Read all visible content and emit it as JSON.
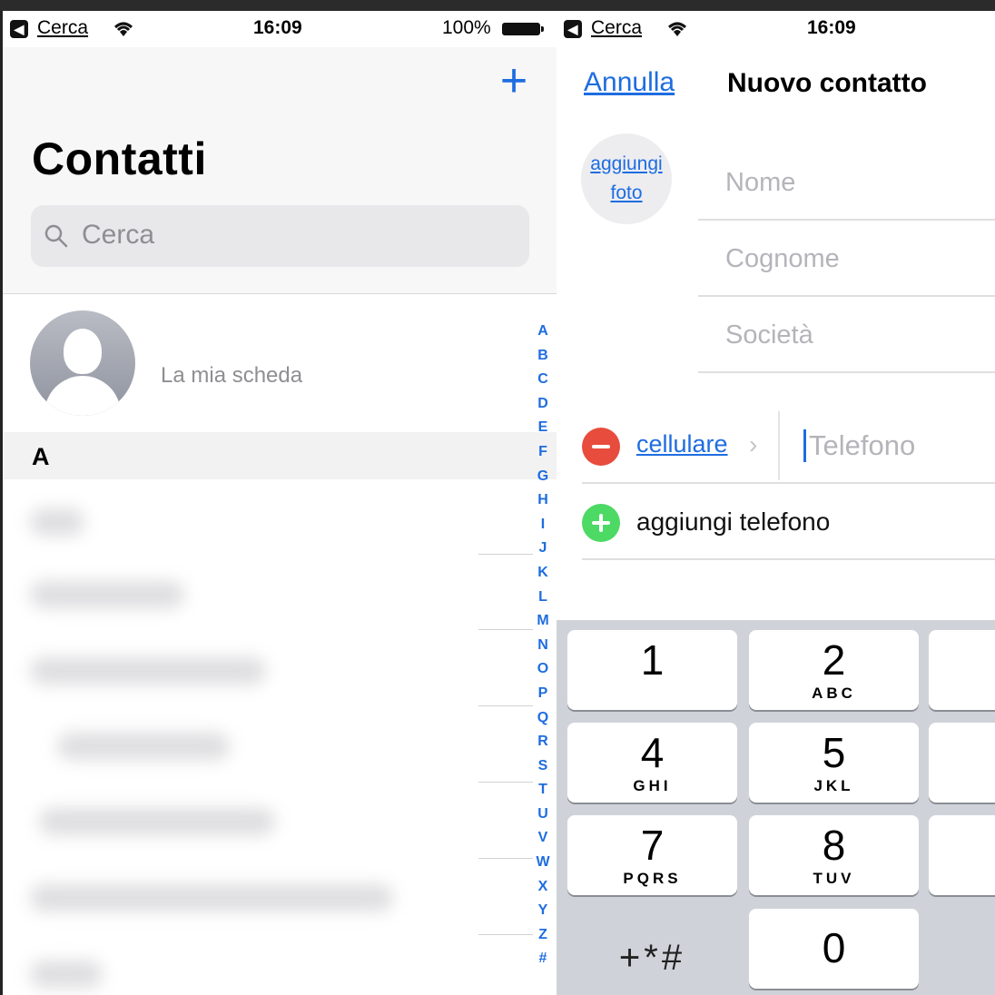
{
  "left": {
    "status": {
      "carrier": "Cerca",
      "time": "16:09",
      "battery": "100%"
    },
    "title": "Contatti",
    "search_placeholder": "Cerca",
    "my_card": "La mia scheda",
    "section_header": "A",
    "index": [
      "A",
      "B",
      "C",
      "D",
      "E",
      "F",
      "G",
      "H",
      "I",
      "J",
      "K",
      "L",
      "M",
      "N",
      "O",
      "P",
      "Q",
      "R",
      "S",
      "T",
      "U",
      "V",
      "W",
      "X",
      "Y",
      "Z",
      "#"
    ]
  },
  "right": {
    "status": {
      "carrier": "Cerca",
      "time": "16:09"
    },
    "cancel": "Annulla",
    "title": "Nuovo contatto",
    "photo": [
      "aggiungi",
      "foto"
    ],
    "fields": {
      "first_name": "Nome",
      "last_name": "Cognome",
      "company": "Società"
    },
    "phone": {
      "type": "cellulare",
      "placeholder": "Telefono"
    },
    "add_phone": "aggiungi telefono",
    "keypad": [
      {
        "num": "1",
        "letters": ""
      },
      {
        "num": "2",
        "letters": "ABC"
      },
      {
        "num": "4",
        "letters": "GHI"
      },
      {
        "num": "5",
        "letters": "JKL"
      },
      {
        "num": "7",
        "letters": "PQRS"
      },
      {
        "num": "8",
        "letters": "TUV"
      },
      {
        "num": "0",
        "letters": ""
      }
    ],
    "keypad_symbols": "+*#"
  },
  "colors": {
    "accent": "#1e6de0",
    "delete": "#e74c3c",
    "add": "#4cd964"
  }
}
